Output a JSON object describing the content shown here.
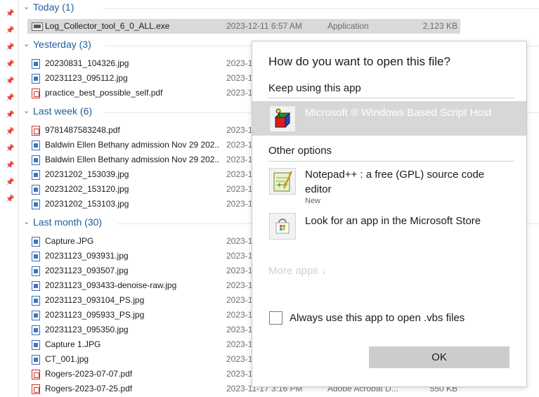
{
  "explorer": {
    "groups": [
      {
        "title": "Today (1)",
        "files": [
          {
            "name": "Log_Collector_tool_6_0_ALL.exe",
            "date": "2023-12-11 6:57 AM",
            "type": "Application",
            "size": "2,123 KB",
            "icon": "exe-icon"
          }
        ]
      },
      {
        "title": "Yesterday (3)",
        "files": [
          {
            "name": "20230831_104326.jpg",
            "date": "2023-1",
            "icon": "image-file-icon"
          },
          {
            "name": "20231123_095112.jpg",
            "date": "2023-1",
            "icon": "image-file-icon"
          },
          {
            "name": "practice_best_possible_self.pdf",
            "date": "2023-1",
            "icon": "pdf-file-icon"
          }
        ]
      },
      {
        "title": "Last week (6)",
        "files": [
          {
            "name": "9781487583248.pdf",
            "date": "2023-1",
            "icon": "pdf-file-icon"
          },
          {
            "name": "Baldwin Ellen Bethany admission Nov 29 202...",
            "date": "2023-1",
            "icon": "image-file-icon"
          },
          {
            "name": "Baldwin Ellen Bethany admission Nov 29 202...",
            "date": "2023-1",
            "icon": "image-file-icon"
          },
          {
            "name": "20231202_153039.jpg",
            "date": "2023-1",
            "icon": "image-file-icon"
          },
          {
            "name": "20231202_153120.jpg",
            "date": "2023-1",
            "icon": "image-file-icon"
          },
          {
            "name": "20231202_153103.jpg",
            "date": "2023-1",
            "icon": "image-file-icon"
          }
        ]
      },
      {
        "title": "Last month (30)",
        "files": [
          {
            "name": "Capture.JPG",
            "date": "2023-1",
            "icon": "image-file-icon"
          },
          {
            "name": "20231123_093931.jpg",
            "date": "2023-1",
            "icon": "image-file-icon"
          },
          {
            "name": "20231123_093507.jpg",
            "date": "2023-1",
            "icon": "image-file-icon"
          },
          {
            "name": "20231123_093433-denoise-raw.jpg",
            "date": "2023-1",
            "icon": "image-file-icon"
          },
          {
            "name": "20231123_093104_PS.jpg",
            "date": "2023-1",
            "icon": "image-file-icon"
          },
          {
            "name": "20231123_095933_PS.jpg",
            "date": "2023-1",
            "icon": "image-file-icon"
          },
          {
            "name": "20231123_095350.jpg",
            "date": "2023-1",
            "icon": "image-file-icon"
          },
          {
            "name": "Capture 1.JPG",
            "date": "2023-1",
            "icon": "image-file-icon"
          },
          {
            "name": "CT_001.jpg",
            "date": "2023-1",
            "icon": "image-file-icon"
          },
          {
            "name": "Rogers-2023-07-07.pdf",
            "date": "2023-1",
            "icon": "pdf-file-icon"
          },
          {
            "name": "Rogers-2023-07-25.pdf",
            "date": "2023-11-17 3:16 PM",
            "type": "Adobe Acrobat D...",
            "size": "550 KB",
            "icon": "pdf-file-icon"
          }
        ]
      }
    ]
  },
  "dialog": {
    "title": "How do you want to open this file?",
    "keep_label": "Keep using this app",
    "current_app": {
      "name": "Microsoft ® Windows Based Script Host",
      "icon": "script-host-icon"
    },
    "other_label": "Other options",
    "options": [
      {
        "name": "Notepad++ : a free (GPL) source code editor",
        "sub": "New",
        "icon": "notepadpp-icon"
      },
      {
        "name": "Look for an app in the Microsoft Store",
        "icon": "store-icon"
      }
    ],
    "more_apps": "More apps ↓",
    "always_label": "Always use this app to open .vbs files",
    "always_checked": false,
    "ok_label": "OK"
  }
}
